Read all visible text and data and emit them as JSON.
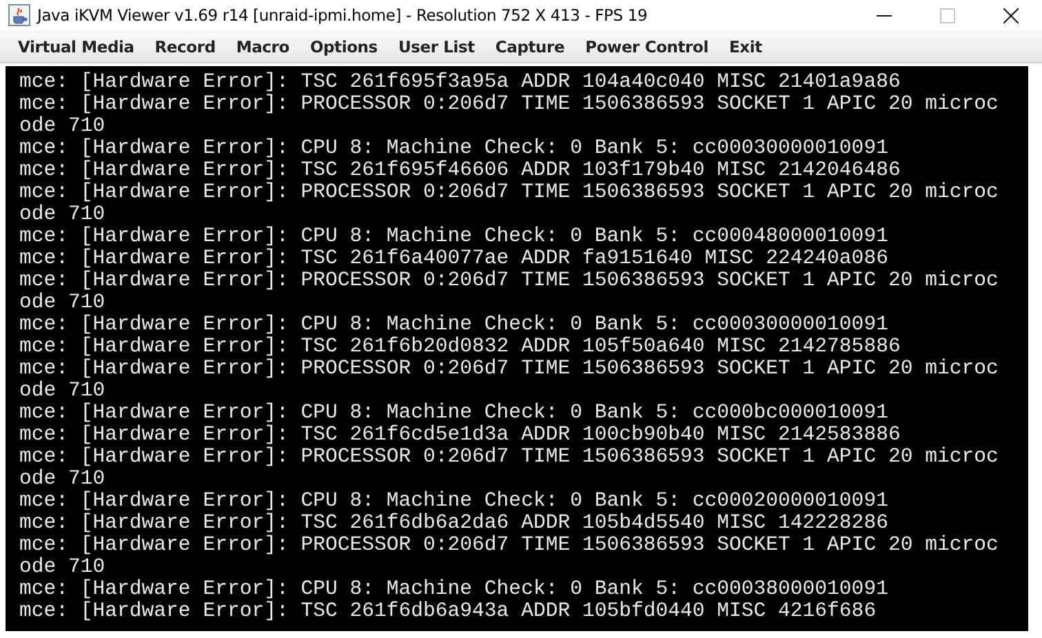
{
  "window": {
    "title": "Java iKVM Viewer v1.69 r14 [unraid-ipmi.home]  - Resolution 752 X 413 - FPS 19",
    "maximize_disabled": true
  },
  "menu": [
    "Virtual Media",
    "Record",
    "Macro",
    "Options",
    "User List",
    "Capture",
    "Power Control",
    "Exit"
  ],
  "console_lines": [
    "mce: [Hardware Error]: TSC 261f695f3a95a ADDR 104a40c040 MISC 21401a9a86",
    "mce: [Hardware Error]: PROCESSOR 0:206d7 TIME 1506386593 SOCKET 1 APIC 20 microc",
    "ode 710",
    "mce: [Hardware Error]: CPU 8: Machine Check: 0 Bank 5: cc00030000010091",
    "mce: [Hardware Error]: TSC 261f695f46606 ADDR 103f179b40 MISC 2142046486",
    "mce: [Hardware Error]: PROCESSOR 0:206d7 TIME 1506386593 SOCKET 1 APIC 20 microc",
    "ode 710",
    "mce: [Hardware Error]: CPU 8: Machine Check: 0 Bank 5: cc00048000010091",
    "mce: [Hardware Error]: TSC 261f6a40077ae ADDR fa9151640 MISC 224240a086",
    "mce: [Hardware Error]: PROCESSOR 0:206d7 TIME 1506386593 SOCKET 1 APIC 20 microc",
    "ode 710",
    "mce: [Hardware Error]: CPU 8: Machine Check: 0 Bank 5: cc00030000010091",
    "mce: [Hardware Error]: TSC 261f6b20d0832 ADDR 105f50a640 MISC 2142785886",
    "mce: [Hardware Error]: PROCESSOR 0:206d7 TIME 1506386593 SOCKET 1 APIC 20 microc",
    "ode 710",
    "mce: [Hardware Error]: CPU 8: Machine Check: 0 Bank 5: cc000bc000010091",
    "mce: [Hardware Error]: TSC 261f6cd5e1d3a ADDR 100cb90b40 MISC 2142583886",
    "mce: [Hardware Error]: PROCESSOR 0:206d7 TIME 1506386593 SOCKET 1 APIC 20 microc",
    "ode 710",
    "mce: [Hardware Error]: CPU 8: Machine Check: 0 Bank 5: cc00020000010091",
    "mce: [Hardware Error]: TSC 261f6db6a2da6 ADDR 105b4d5540 MISC 142228286",
    "mce: [Hardware Error]: PROCESSOR 0:206d7 TIME 1506386593 SOCKET 1 APIC 20 microc",
    "ode 710",
    "mce: [Hardware Error]: CPU 8: Machine Check: 0 Bank 5: cc00038000010091",
    "mce: [Hardware Error]: TSC 261f6db6a943a ADDR 105bfd0440 MISC 4216f686"
  ]
}
